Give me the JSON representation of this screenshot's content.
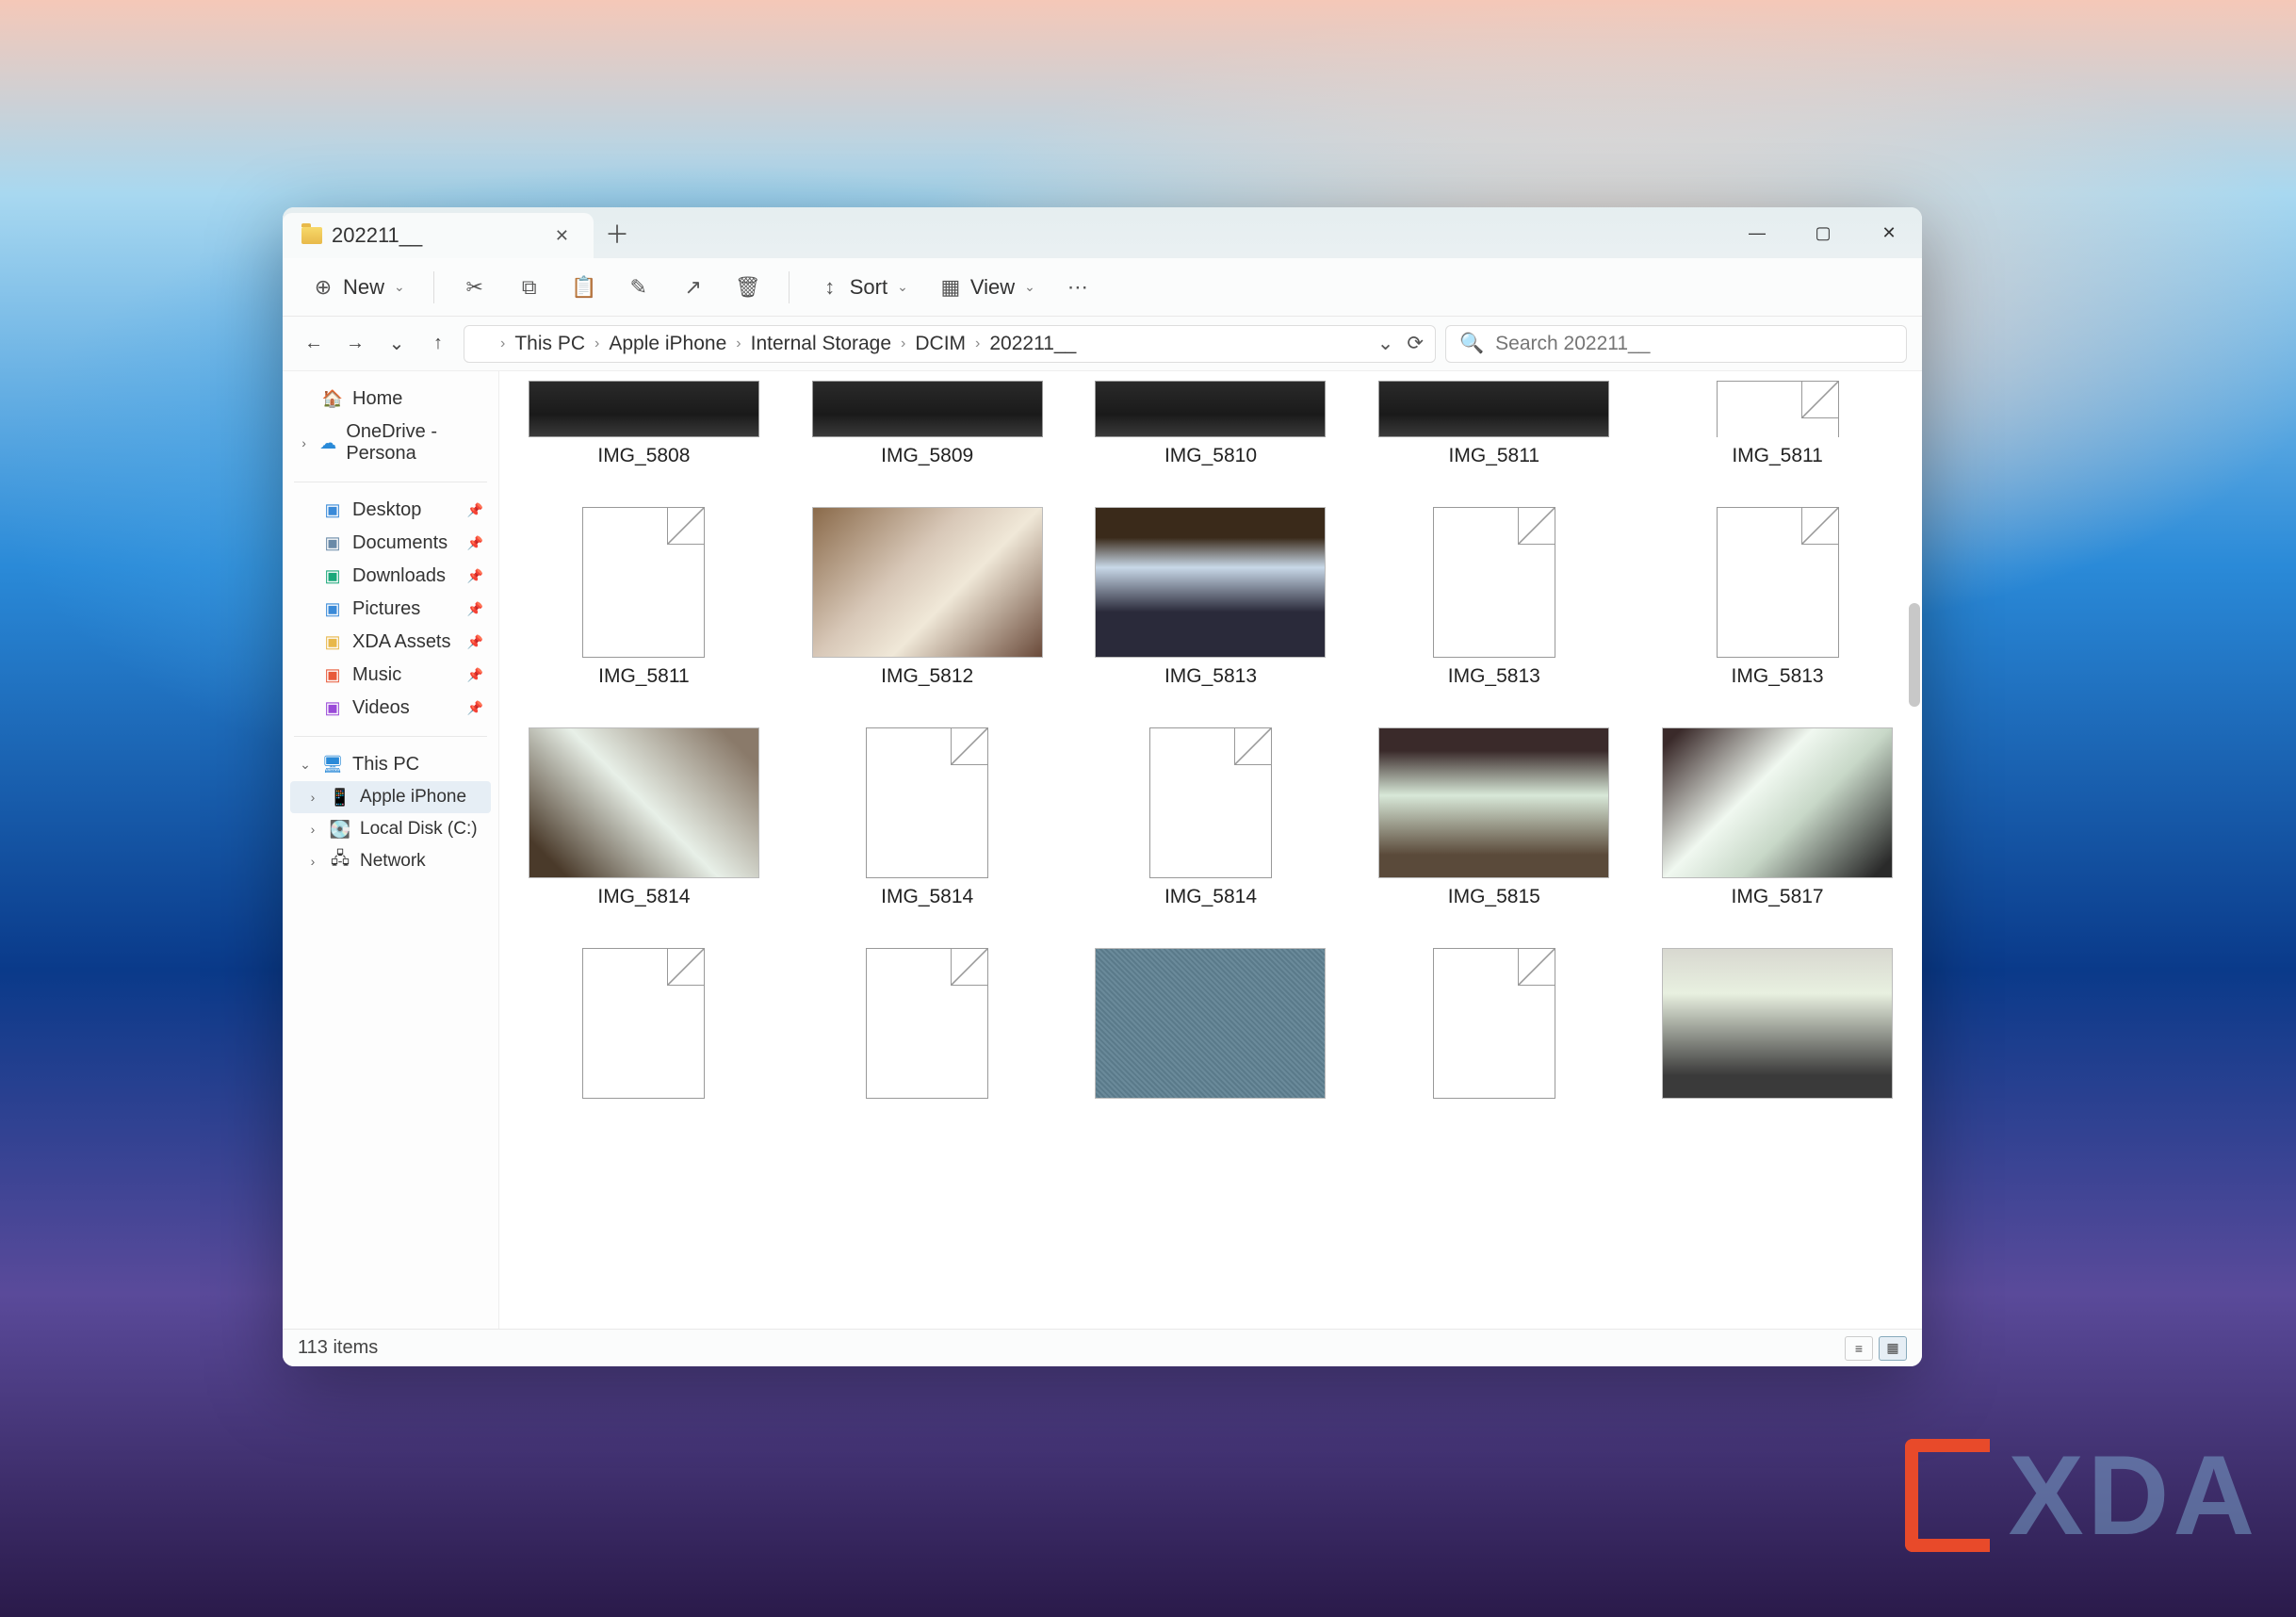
{
  "tab": {
    "title": "202211__"
  },
  "window_controls": {
    "min": "—",
    "max": "▢",
    "close": "✕"
  },
  "toolbar": {
    "new_label": "New",
    "sort_label": "Sort",
    "view_label": "View"
  },
  "breadcrumb": {
    "parts": [
      "This PC",
      "Apple iPhone",
      "Internal Storage",
      "DCIM",
      "202211__"
    ]
  },
  "search": {
    "placeholder": "Search 202211__"
  },
  "sidebar": {
    "home": "Home",
    "onedrive": "OneDrive - Persona",
    "quick": [
      {
        "label": "Desktop",
        "color": "#3a8ad8"
      },
      {
        "label": "Documents",
        "color": "#6a8aa8"
      },
      {
        "label": "Downloads",
        "color": "#1aa87a"
      },
      {
        "label": "Pictures",
        "color": "#3a8ad8"
      },
      {
        "label": "XDA Assets",
        "color": "#e8b84a"
      },
      {
        "label": "Music",
        "color": "#e85a3a"
      },
      {
        "label": "Videos",
        "color": "#9a4ad8"
      }
    ],
    "thispc": "This PC",
    "thispc_items": [
      {
        "label": "Apple iPhone",
        "active": true
      },
      {
        "label": "Local Disk (C:)",
        "active": false
      },
      {
        "label": "Network",
        "active": false
      }
    ]
  },
  "files": {
    "row0": [
      {
        "name": "IMG_5808",
        "type": "laptop"
      },
      {
        "name": "IMG_5809",
        "type": "laptop"
      },
      {
        "name": "IMG_5810",
        "type": "laptop"
      },
      {
        "name": "IMG_5811",
        "type": "laptop"
      },
      {
        "name": "IMG_5811",
        "type": "generic"
      }
    ],
    "row1": [
      {
        "name": "IMG_5811",
        "type": "generic"
      },
      {
        "name": "IMG_5812",
        "type": "photo1"
      },
      {
        "name": "IMG_5813",
        "type": "photo2"
      },
      {
        "name": "IMG_5813",
        "type": "generic"
      },
      {
        "name": "IMG_5813",
        "type": "generic"
      }
    ],
    "row2": [
      {
        "name": "IMG_5814",
        "type": "photo3"
      },
      {
        "name": "IMG_5814",
        "type": "generic"
      },
      {
        "name": "IMG_5814",
        "type": "generic"
      },
      {
        "name": "IMG_5815",
        "type": "photo4"
      },
      {
        "name": "IMG_5817",
        "type": "photo5"
      }
    ],
    "row3": [
      {
        "name": "",
        "type": "generic"
      },
      {
        "name": "",
        "type": "generic"
      },
      {
        "name": "",
        "type": "fabric"
      },
      {
        "name": "",
        "type": "generic"
      },
      {
        "name": "",
        "type": "monitor"
      }
    ]
  },
  "status": {
    "count": "113 items"
  },
  "watermark": "XDA"
}
